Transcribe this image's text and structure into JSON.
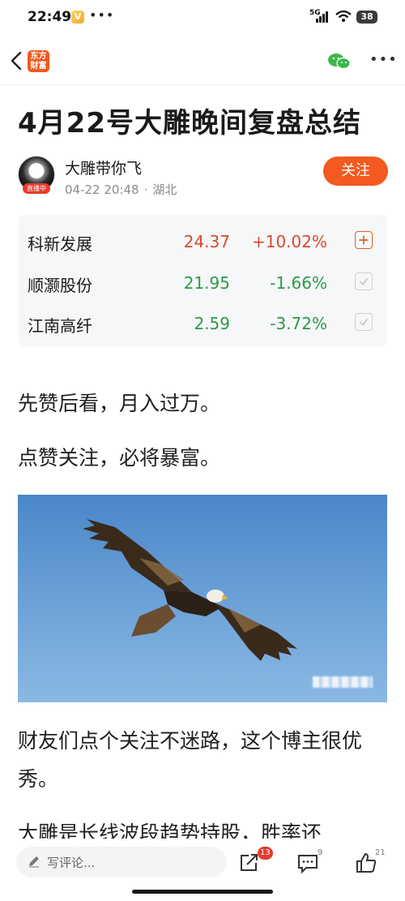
{
  "status_bar": {
    "time": "22:49",
    "network": "5G",
    "battery": "38"
  },
  "nav": {
    "app_logo_line1": "东方",
    "app_logo_line2": "财富"
  },
  "article": {
    "title": "4月22号大雕晚间复盘总结",
    "author": {
      "name": "大雕带你飞",
      "badge": "直播中",
      "time": "04-22 20:48",
      "location": "湖北",
      "follow_label": "关注"
    },
    "stocks": [
      {
        "name": "科新发展",
        "price": "24.37",
        "change": "+10.02%",
        "trend": "up",
        "action": "add"
      },
      {
        "name": "顺灏股份",
        "price": "21.95",
        "change": "-1.66%",
        "trend": "down",
        "action": "added"
      },
      {
        "name": "江南高纤",
        "price": "2.59",
        "change": "-3.72%",
        "trend": "down",
        "action": "added"
      }
    ],
    "paragraphs": [
      "先赞后看，月入过万。",
      "点赞关注，必将暴富。",
      "财友们点个关注不迷路，这个博主很优秀。",
      "大雕是长线波段趋势持股，胜率还"
    ]
  },
  "bottom_bar": {
    "comment_placeholder": "写评论...",
    "share_count": "13",
    "comment_count": "9",
    "like_count": "21"
  },
  "colors": {
    "accent": "#f4591f",
    "up": "#d94a2e",
    "down": "#2a9a47"
  }
}
